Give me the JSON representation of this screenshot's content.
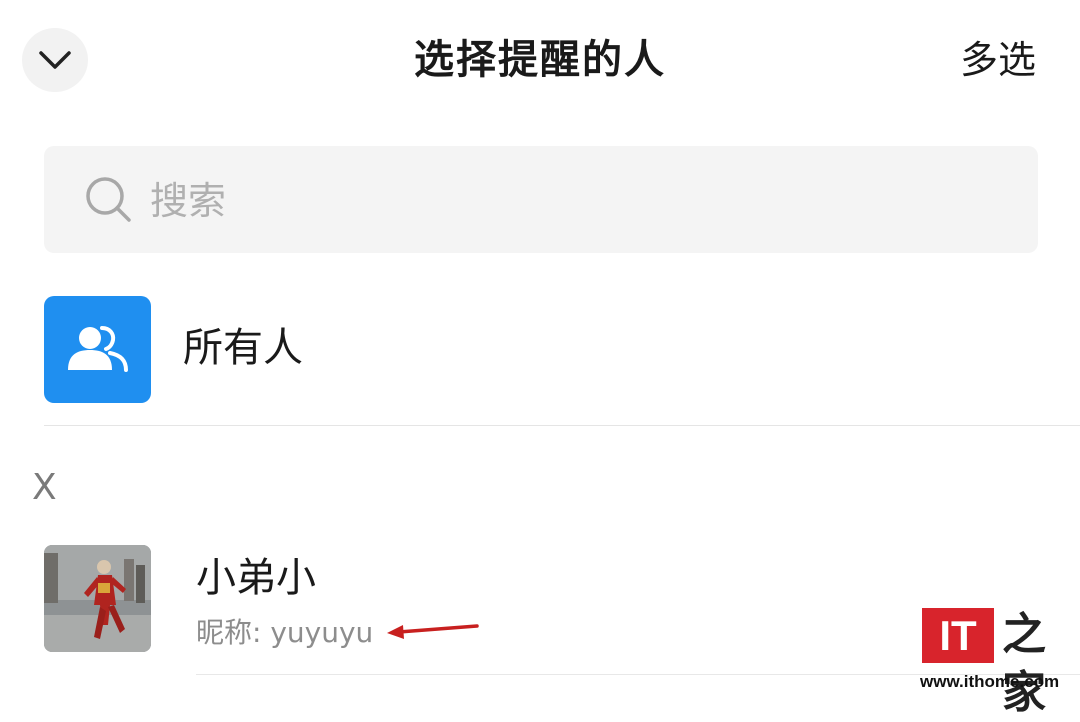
{
  "header": {
    "collapse_icon": "chevron-down-icon",
    "title": "选择提醒的人",
    "multi_select_label": "多选"
  },
  "search": {
    "placeholder": "搜索",
    "value": "",
    "icon": "search-icon"
  },
  "everyone": {
    "label": "所有人",
    "icon": "group-icon",
    "icon_bg": "#1f8ff0"
  },
  "sections": [
    {
      "letter": "X",
      "contacts": [
        {
          "name": "小弟小",
          "nickname_line": "昵称: yuyuyu",
          "annotation": "red-arrow-left"
        }
      ]
    }
  ],
  "watermark": {
    "logo": "IT",
    "chars": "之家",
    "url": "www.ithome.com",
    "logo_color": "#d8242c"
  }
}
